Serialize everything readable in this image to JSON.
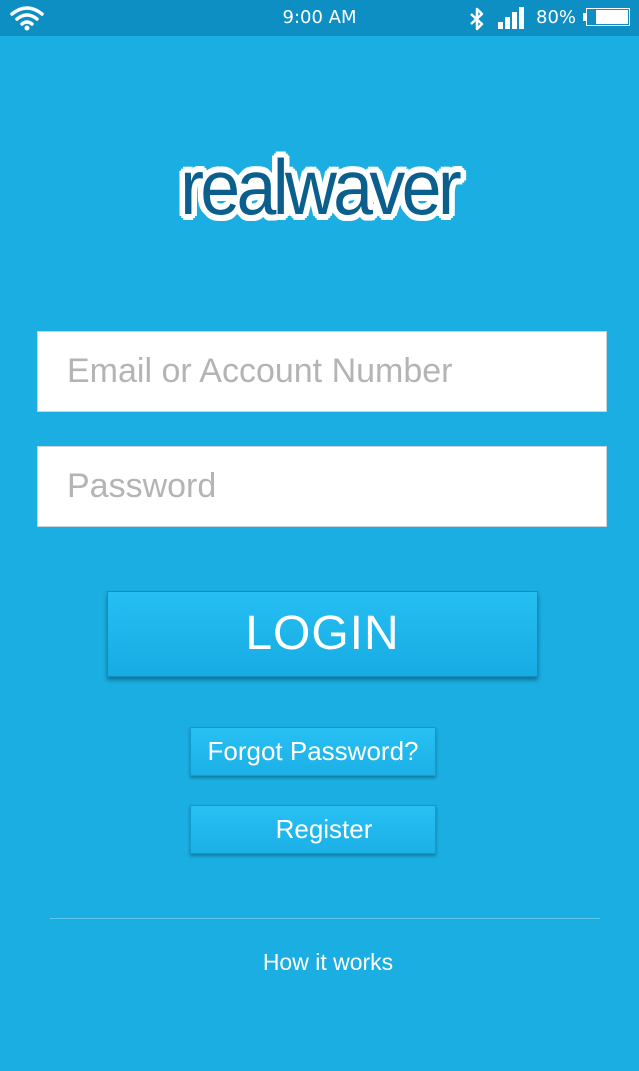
{
  "status_bar": {
    "time": "9:00 AM",
    "battery_percent": "80%",
    "battery_level": 0.8,
    "wifi_icon": "wifi-icon",
    "bluetooth_icon": "bluetooth-icon",
    "signal_icon": "cellular-signal-icon"
  },
  "logo": {
    "text": "realwaver"
  },
  "login_form": {
    "email_placeholder": "Email or Account Number",
    "email_value": "",
    "password_placeholder": "Password",
    "password_value": "",
    "login_label": "LOGIN",
    "forgot_label": "Forgot Password?",
    "register_label": "Register"
  },
  "footer": {
    "how_it_works_label": "How it works"
  },
  "colors": {
    "background": "#1aaee2",
    "status_bar": "#0e8fc4",
    "logo_text": "#0a5f8c",
    "button_text": "#ffffff"
  }
}
